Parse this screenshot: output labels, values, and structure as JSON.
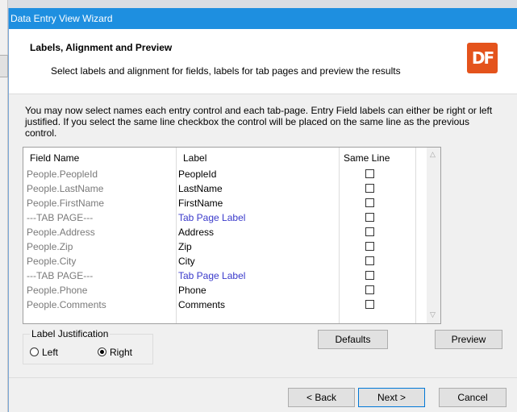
{
  "window": {
    "title": "Data Entry View Wizard"
  },
  "header": {
    "title": "Labels, Alignment and Preview",
    "subtitle": "Select labels and alignment for fields, labels for tab pages and preview the results",
    "logo": "DF"
  },
  "description": "You may now select names each entry control and each tab-page. Entry Field labels can either be right or left justified. If you select the same line checkbox the control will be placed on the same line as the previous control.",
  "grid": {
    "columns": [
      "Field Name",
      "Label",
      "Same Line"
    ],
    "rows": [
      {
        "field": "People.PeopleId",
        "label": "PeopleId",
        "tab": false,
        "same_line": false
      },
      {
        "field": "People.LastName",
        "label": "LastName",
        "tab": false,
        "same_line": false
      },
      {
        "field": "People.FirstName",
        "label": "FirstName",
        "tab": false,
        "same_line": false
      },
      {
        "field": "---TAB PAGE---",
        "label": "Tab Page Label",
        "tab": true,
        "same_line": false
      },
      {
        "field": "People.Address",
        "label": "Address",
        "tab": false,
        "same_line": false
      },
      {
        "field": "People.Zip",
        "label": "Zip",
        "tab": false,
        "same_line": false
      },
      {
        "field": "People.City",
        "label": "City",
        "tab": false,
        "same_line": false
      },
      {
        "field": "---TAB PAGE---",
        "label": "Tab Page Label",
        "tab": true,
        "same_line": false
      },
      {
        "field": "People.Phone",
        "label": "Phone",
        "tab": false,
        "same_line": false
      },
      {
        "field": "People.Comments",
        "label": "Comments",
        "tab": false,
        "same_line": false
      }
    ]
  },
  "justification": {
    "legend": "Label Justification",
    "left": "Left",
    "right": "Right",
    "selected": "Right"
  },
  "buttons": {
    "defaults": "Defaults",
    "preview": "Preview",
    "back": "< Back",
    "next": "Next >",
    "cancel": "Cancel"
  }
}
